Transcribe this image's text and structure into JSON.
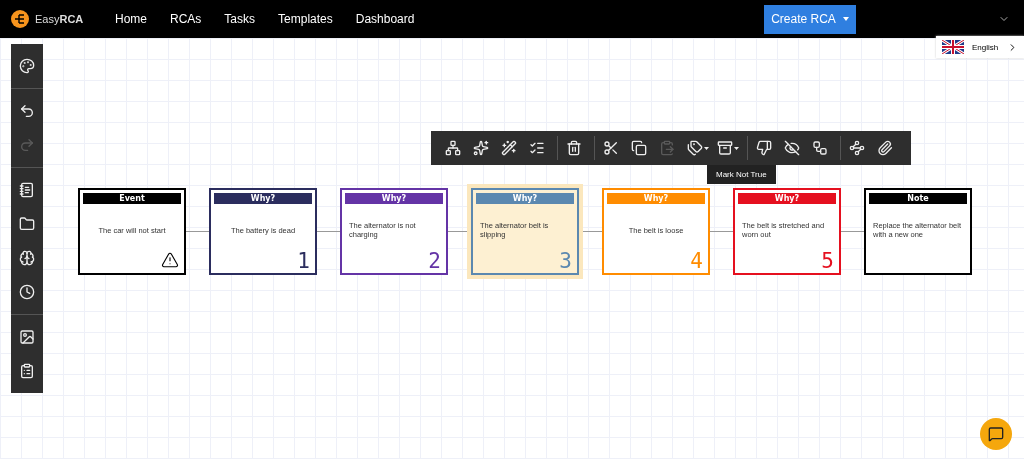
{
  "navbar": {
    "logo": {
      "prefix": "Easy",
      "bold": "RCA"
    },
    "links": [
      "Home",
      "RCAs",
      "Tasks",
      "Templates",
      "Dashboard"
    ],
    "create_button": "Create RCA"
  },
  "language": {
    "label": "English"
  },
  "sidebar": {
    "groups": [
      [
        {
          "disabled": false
        }
      ],
      [
        {
          "disabled": false
        },
        {
          "disabled": true
        }
      ],
      [
        {
          "disabled": false
        },
        {
          "disabled": false
        },
        {
          "disabled": false
        },
        {
          "disabled": false
        }
      ],
      [
        {
          "disabled": false
        },
        {
          "disabled": false
        }
      ]
    ]
  },
  "toolbar": {
    "groups": [
      [
        {
          "disabled": false
        },
        {
          "disabled": false
        },
        {
          "disabled": false
        },
        {
          "disabled": false
        }
      ],
      [
        {
          "disabled": false
        }
      ],
      [
        {
          "disabled": false
        },
        {
          "disabled": false
        },
        {
          "disabled": true
        },
        {
          "disabled": false
        },
        {
          "disabled": false
        }
      ],
      [
        {
          "disabled": false
        },
        {
          "disabled": false
        },
        {
          "disabled": false
        }
      ],
      [
        {
          "disabled": false
        },
        {
          "disabled": false
        }
      ]
    ],
    "tooltip": "Mark Not True"
  },
  "nodes": [
    {
      "kind": "event",
      "header": "Event",
      "text": "The car will not start",
      "color": "#000000",
      "selected": false
    },
    {
      "kind": "why",
      "header": "Why?",
      "text": "The battery is dead",
      "number": "1",
      "color": "#2b2d5e",
      "selected": false
    },
    {
      "kind": "why",
      "header": "Why?",
      "text": "The alternator is not charging",
      "number": "2",
      "color": "#6434a6",
      "selected": false
    },
    {
      "kind": "why",
      "header": "Why?",
      "text": "The alternator belt is slipping",
      "number": "3",
      "color": "#5b88b0",
      "selected": true
    },
    {
      "kind": "why",
      "header": "Why?",
      "text": "The belt is loose",
      "number": "4",
      "color": "#ff8c00",
      "selected": false
    },
    {
      "kind": "why",
      "header": "Why?",
      "text": "The belt is stretched and worn out",
      "number": "5",
      "color": "#e5101f",
      "selected": false
    },
    {
      "kind": "note",
      "header": "Note",
      "text": "Replace the alternator belt with a new one",
      "color": "#000000",
      "selected": false
    }
  ]
}
